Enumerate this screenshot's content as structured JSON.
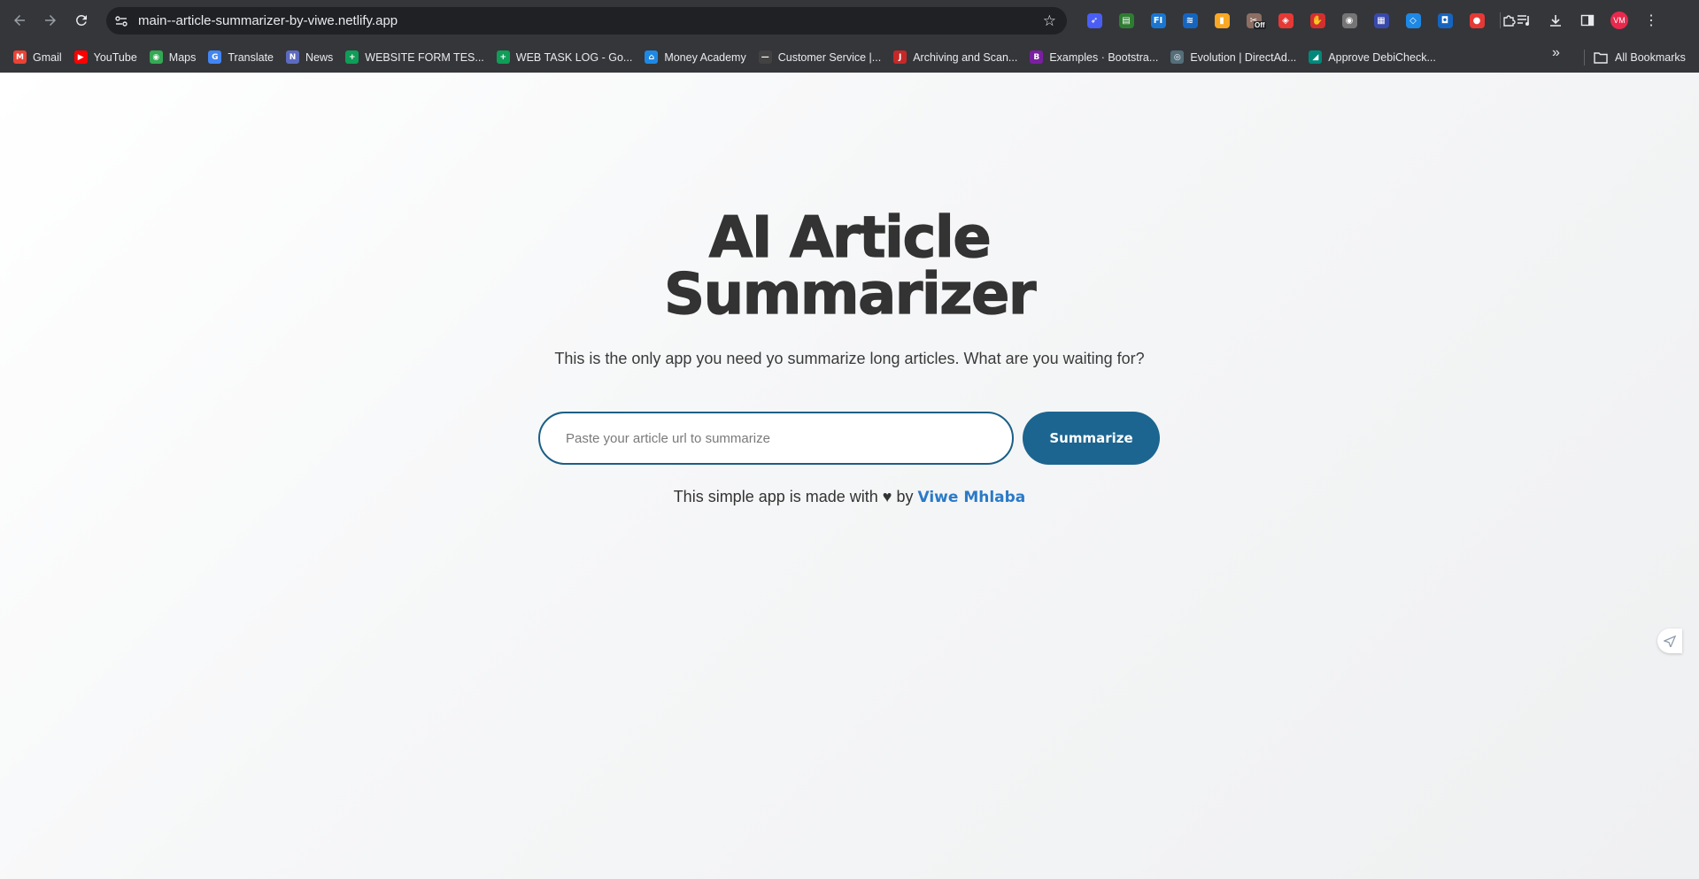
{
  "browser": {
    "url": "main--article-summarizer-by-viwe.netlify.app",
    "extensions": [
      {
        "name": "rocket-extension-icon",
        "color": "#4a5ef5",
        "glyph": "➶"
      },
      {
        "name": "green-extension-icon",
        "color": "#2e7d32",
        "glyph": "▤"
      },
      {
        "name": "fi-extension-icon",
        "color": "#1976d2",
        "glyph": "FI"
      },
      {
        "name": "wave-extension-icon",
        "color": "#1565c0",
        "glyph": "≋"
      },
      {
        "name": "yellow-extension-icon",
        "color": "#f9a825",
        "glyph": "▮"
      },
      {
        "name": "scissors-extension-icon",
        "color": "#8d6e63",
        "glyph": "✂"
      },
      {
        "name": "red-layer-extension-icon",
        "color": "#e53935",
        "glyph": "◈"
      },
      {
        "name": "hand-stop-extension-icon",
        "color": "#d32f2f",
        "glyph": "✋"
      },
      {
        "name": "camera-extension-icon",
        "color": "#757575",
        "glyph": "◉"
      },
      {
        "name": "flag-extension-icon",
        "color": "#3949ab",
        "glyph": "▦"
      },
      {
        "name": "diamond-extension-icon",
        "color": "#1e88e5",
        "glyph": "◇"
      },
      {
        "name": "blue-square-extension-icon",
        "color": "#1565c0",
        "glyph": "◘"
      },
      {
        "name": "red-circle-extension-icon",
        "color": "#e53935",
        "glyph": "●"
      }
    ],
    "extension_badge": "Off",
    "avatar_initials": "VM",
    "bookmarks": [
      {
        "label": "Gmail",
        "color": "#ea4335",
        "glyph": "M"
      },
      {
        "label": "YouTube",
        "color": "#ff0000",
        "glyph": "▶"
      },
      {
        "label": "Maps",
        "color": "#34a853",
        "glyph": "◉"
      },
      {
        "label": "Translate",
        "color": "#4285f4",
        "glyph": "G"
      },
      {
        "label": "News",
        "color": "#5c6bc0",
        "glyph": "N"
      },
      {
        "label": "WEBSITE FORM TES...",
        "color": "#0f9d58",
        "glyph": "+"
      },
      {
        "label": "WEB TASK LOG - Go...",
        "color": "#0f9d58",
        "glyph": "+"
      },
      {
        "label": "Money Academy",
        "color": "#1e88e5",
        "glyph": "⌂"
      },
      {
        "label": "Customer Service |...",
        "color": "#424242",
        "glyph": "—"
      },
      {
        "label": "Archiving and Scan...",
        "color": "#c62828",
        "glyph": "J"
      },
      {
        "label": "Examples · Bootstra...",
        "color": "#7b1fa2",
        "glyph": "B"
      },
      {
        "label": "Evolution | DirectAd...",
        "color": "#546e7a",
        "glyph": "◎"
      },
      {
        "label": "Approve DebiCheck...",
        "color": "#00897b",
        "glyph": "◢"
      }
    ],
    "all_bookmarks_label": "All Bookmarks"
  },
  "page": {
    "title_line1": "AI Article",
    "title_line2": "Summarizer",
    "subtitle": "This is the only app you need yo summarize long articles. What are you waiting for?",
    "input_placeholder": "Paste your article url to summarize",
    "input_value": "",
    "button_label": "Summarize",
    "footer_prefix": "This simple app is made with ♥ by ",
    "footer_author": "Viwe Mhlaba"
  },
  "colors": {
    "accent": "#1c6590",
    "link": "#2a7ac8",
    "title": "#333333"
  }
}
